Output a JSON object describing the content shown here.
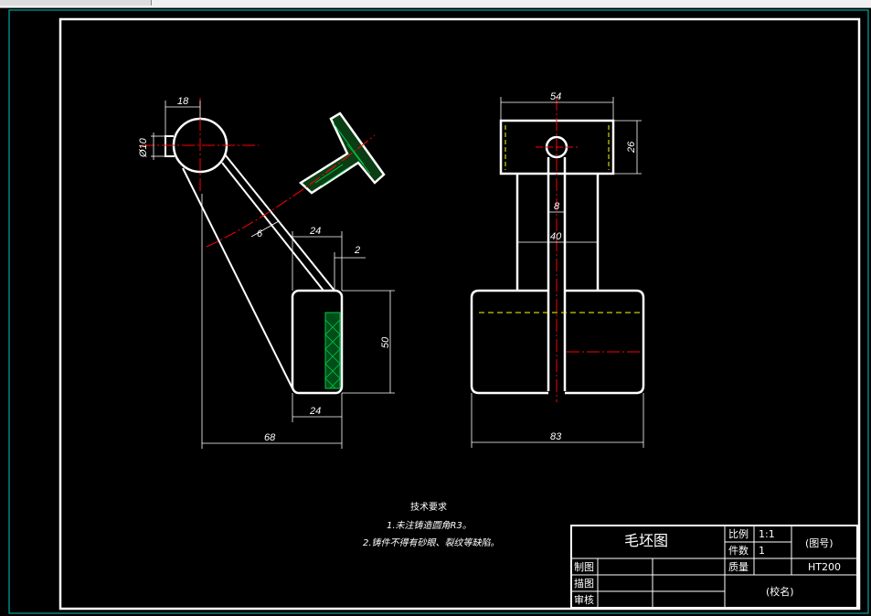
{
  "drawing": {
    "dimensions": {
      "d18": "18",
      "dia10": "Ø10",
      "d6": "6",
      "d24_top": "24",
      "d2": "2",
      "d50": "50",
      "d24_bottom": "24",
      "d68": "68",
      "d54": "54",
      "d26": "26",
      "d8": "8",
      "d40": "40",
      "d83": "83"
    },
    "notes": {
      "title": "技术要求",
      "line1": "1.未注铸造圆角R3。",
      "line2": "2.铸件不得有砂眼、裂纹等缺陷。"
    }
  },
  "title_block": {
    "name": "毛坯图",
    "scale_label": "比例",
    "scale_value": "1:1",
    "count_label": "件数",
    "count_value": "1",
    "material_label": "质量",
    "material_value": "HT200",
    "drawing_no": "(图号)",
    "drawn_label": "制图",
    "traced_label": "描图",
    "checked_label": "审核",
    "school": "(校名)"
  },
  "colors": {
    "background": "#000000",
    "lines": "#ffffff",
    "centerline": "#ff0000",
    "hatch": "#00cc44",
    "hidden": "#ffff00",
    "border_outer": "#00c8c8"
  }
}
